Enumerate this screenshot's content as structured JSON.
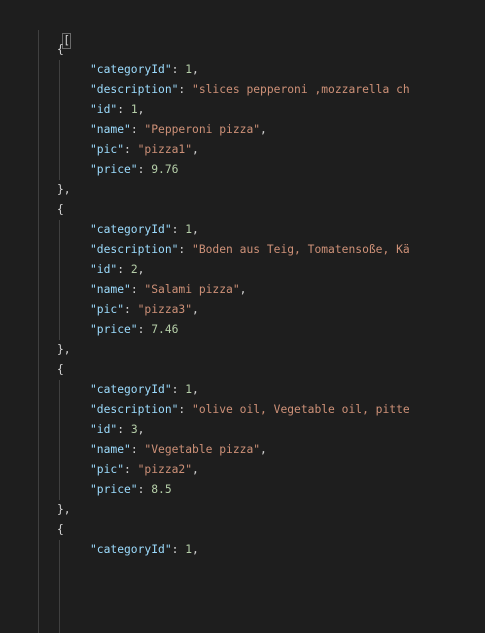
{
  "editor": {
    "open_bracket": "[",
    "colors": {
      "background": "#1e1e1e",
      "key": "#9cdcfe",
      "string": "#ce9178",
      "number": "#b5cea8",
      "punctuation": "#d4d4d4"
    },
    "lines": [
      {
        "indent": 1,
        "punct": "{"
      },
      {
        "indent": 2,
        "key": "\"categoryId\"",
        "sep": ": ",
        "value": "1",
        "vtype": "num",
        "trail": ","
      },
      {
        "indent": 2,
        "key": "\"description\"",
        "sep": ": ",
        "value": "\"slices pepperoni ,mozzarella ch",
        "vtype": "str",
        "trail": ""
      },
      {
        "indent": 2,
        "key": "\"id\"",
        "sep": ": ",
        "value": "1",
        "vtype": "num",
        "trail": ","
      },
      {
        "indent": 2,
        "key": "\"name\"",
        "sep": ": ",
        "value": "\"Pepperoni pizza\"",
        "vtype": "str",
        "trail": ","
      },
      {
        "indent": 2,
        "key": "\"pic\"",
        "sep": ": ",
        "value": "\"pizza1\"",
        "vtype": "str",
        "trail": ","
      },
      {
        "indent": 2,
        "key": "\"price\"",
        "sep": ": ",
        "value": "9.76",
        "vtype": "num",
        "trail": ""
      },
      {
        "indent": 1,
        "punct": "},"
      },
      {
        "indent": 1,
        "punct": "{"
      },
      {
        "indent": 2,
        "key": "\"categoryId\"",
        "sep": ": ",
        "value": "1",
        "vtype": "num",
        "trail": ","
      },
      {
        "indent": 2,
        "key": "\"description\"",
        "sep": ": ",
        "value": "\"Boden aus Teig, Tomatensoße, Kä",
        "vtype": "str",
        "trail": ""
      },
      {
        "indent": 2,
        "key": "\"id\"",
        "sep": ": ",
        "value": "2",
        "vtype": "num",
        "trail": ","
      },
      {
        "indent": 2,
        "key": "\"name\"",
        "sep": ": ",
        "value": "\"Salami pizza\"",
        "vtype": "str",
        "trail": ","
      },
      {
        "indent": 2,
        "key": "\"pic\"",
        "sep": ": ",
        "value": "\"pizza3\"",
        "vtype": "str",
        "trail": ","
      },
      {
        "indent": 2,
        "key": "\"price\"",
        "sep": ": ",
        "value": "7.46",
        "vtype": "num",
        "trail": ""
      },
      {
        "indent": 1,
        "punct": "},"
      },
      {
        "indent": 1,
        "punct": "{"
      },
      {
        "indent": 2,
        "key": "\"categoryId\"",
        "sep": ": ",
        "value": "1",
        "vtype": "num",
        "trail": ","
      },
      {
        "indent": 2,
        "key": "\"description\"",
        "sep": ": ",
        "value": "\"olive oil, Vegetable oil, pitte",
        "vtype": "str",
        "trail": ""
      },
      {
        "indent": 2,
        "key": "\"id\"",
        "sep": ": ",
        "value": "3",
        "vtype": "num",
        "trail": ","
      },
      {
        "indent": 2,
        "key": "\"name\"",
        "sep": ": ",
        "value": "\"Vegetable pizza\"",
        "vtype": "str",
        "trail": ","
      },
      {
        "indent": 2,
        "key": "\"pic\"",
        "sep": ": ",
        "value": "\"pizza2\"",
        "vtype": "str",
        "trail": ","
      },
      {
        "indent": 2,
        "key": "\"price\"",
        "sep": ": ",
        "value": "8.5",
        "vtype": "num",
        "trail": ""
      },
      {
        "indent": 1,
        "punct": "},"
      },
      {
        "indent": 1,
        "punct": "{"
      },
      {
        "indent": 2,
        "key": "\"categoryId\"",
        "sep": ": ",
        "value": "1",
        "vtype": "num",
        "trail": ","
      }
    ]
  }
}
